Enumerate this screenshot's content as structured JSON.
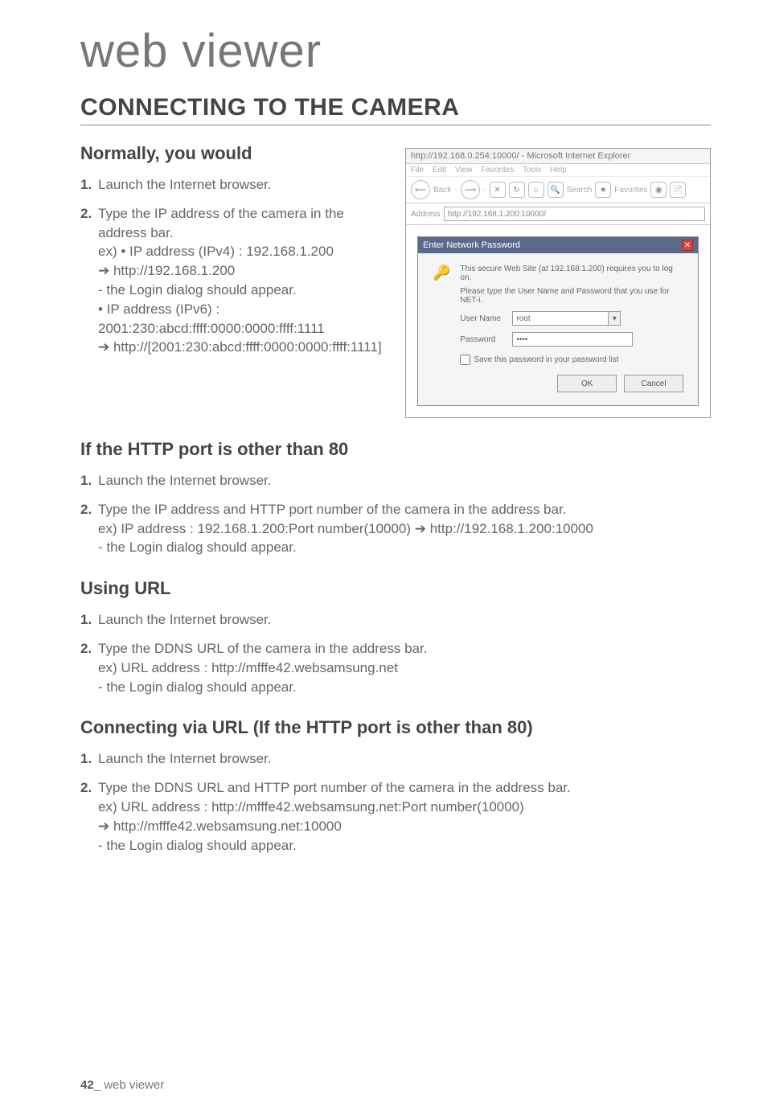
{
  "page": {
    "title_text": "web viewer",
    "section_heading": "CONNECTING TO THE CAMERA",
    "footer_num": "42",
    "footer_label": "_ web viewer"
  },
  "normally": {
    "heading": "Normally, you would",
    "step1": "Launch the Internet browser.",
    "step2_intro": "Type the IP address of the camera in the address bar.",
    "step2_ex1": "ex) • IP address (IPv4) : 192.168.1.200",
    "step2_ex1b": "http://192.168.1.200",
    "step2_login": "- the Login dialog should appear.",
    "step2_ex2a": "• IP address (IPv6) : 2001:230:abcd:ffff:0000:0000:ffff:1111",
    "step2_ex2b": "http://[2001:230:abcd:ffff:0000:0000:ffff:1111]"
  },
  "dialog": {
    "title": "http://192.168.0.254:10000/ - Microsoft Internet Explorer",
    "menu": {
      "file": "File",
      "edit": "Edit",
      "view": "View",
      "fav": "Favorites",
      "tools": "Tools",
      "help": "Help"
    },
    "toolbar": {
      "back": "Back",
      "search": "Search",
      "favorites": "Favorites"
    },
    "address_label": "Address",
    "address_value": "http://192.168.1.200:10000/",
    "auth": {
      "title": "Enter Network Password",
      "line1": "This secure Web Site (at 192.168.1.200) requires you to log on.",
      "line2": "Please type the User Name and Password that you use for NET-i.",
      "user_label": "User Name",
      "user_value": "root",
      "pass_label": "Password",
      "pass_value": "••••",
      "save_label": "Save this password in your password list",
      "ok": "OK",
      "cancel": "Cancel"
    }
  },
  "httpport": {
    "heading": "If the HTTP port is other than 80",
    "step1": "Launch the Internet browser.",
    "step2_a": "Type the IP address and HTTP port number of the camera in the address bar.",
    "step2_b": "ex) IP address : 192.168.1.200:Port number(10000) ➔ http://192.168.1.200:10000",
    "step2_c": "- the Login dialog should appear."
  },
  "usingurl": {
    "heading": "Using URL",
    "step1": "Launch the Internet browser.",
    "step2_a": "Type the DDNS URL of the camera in the address bar.",
    "step2_b": "ex) URL address : http://mfffe42.websamsung.net",
    "step2_c": "- the Login dialog should appear."
  },
  "connvia": {
    "heading": "Connecting via URL (If the HTTP port is other than 80)",
    "step1": "Launch the Internet browser.",
    "step2_a": "Type the DDNS URL and HTTP port number of the camera in the address bar.",
    "step2_b": "ex) URL address : http://mfffe42.websamsung.net:Port number(10000)",
    "step2_c": "http://mfffe42.websamsung.net:10000",
    "step2_d": "- the Login dialog should appear."
  }
}
